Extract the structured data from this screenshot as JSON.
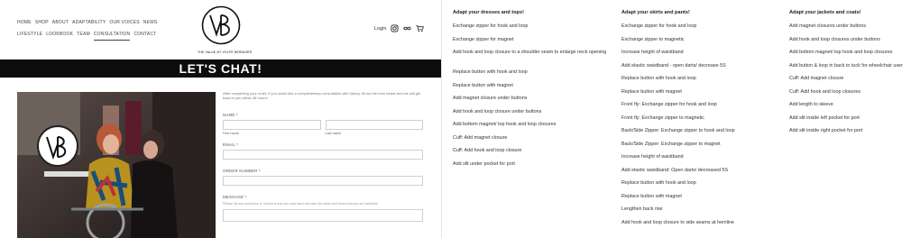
{
  "nav": {
    "row1": [
      "HOME",
      "SHOP",
      "ABOUT",
      "ADAPTABILITY",
      "OUR VOICES",
      "NEWS"
    ],
    "row2": [
      "LIFESTYLE",
      "LOOKBOOK",
      "TEAM",
      "CONSULTATION",
      "CONTACT"
    ],
    "active": "CONSULTATION"
  },
  "logo": {
    "caption": "THE VALUE BY VOLPE BERNIGER",
    "letters": "VB"
  },
  "header_tools": {
    "login": "Login",
    "icons": [
      "instagram-icon",
      "infinity-icon",
      "cart-icon"
    ]
  },
  "banner": {
    "title": "LET'S CHAT!"
  },
  "form": {
    "intro": "After completing your order, if you would like a complimentary consultation with Nancy, fill out the form below and we will get back to you within 48 hours!",
    "name_label": "NAME *",
    "first_name_sub": "First name",
    "last_name_sub": "Last name",
    "email_label": "EMAIL *",
    "order_label": "ORDER NUMBER *",
    "message_label": "MESSAGE *",
    "message_help": "Please list any questions or concerns that you may have and also the dates and times that you are available."
  },
  "lists": [
    {
      "title": "Adapt your dresses and tops!",
      "items": [
        "Exchange zipper for hook and loop",
        "Exchange zipper for magnet",
        "Add hook and loop closure to a shoulder seam to enlarge neck opening",
        "Replace button with hook and loop",
        "Replace button with magnet",
        "Add magnet closure under buttons",
        "Add hook and loop closure under buttons",
        "Add bottom magnet/ top hook and loop closures",
        "Cuff: Add magnet closure",
        "Cuff: Add hook and loop closure",
        "Add slit under pocket for port"
      ]
    },
    {
      "title": "Adapt your skirts and pants!",
      "items": [
        "Exchange zipper for hook and loop",
        "Exchange zipper to magnetic",
        "Increase height of waistband",
        "Add elastic waistband - open darts/ decrease 5S",
        "Replace button with hook and loop",
        "Replace button with magnet",
        "Front fly: Exchange zipper for hook and loop",
        "Front fly: Exchange zipper to magnetic",
        "Back/Side Zipper: Exchange zipper to hook and loop",
        "Back/Side Zipper: Exchange zipper to magnet",
        "Increase height of waistband",
        "Add elastic waistband: Open darts/ decreased 5S",
        "Replace button with hook and loop",
        "Replace button with magnet",
        "Lengthen back rise",
        "Add hook and loop closure to side seams at hemline"
      ]
    },
    {
      "title": "Adapt your jackets and coats!",
      "items": [
        "Add magnet closures under buttons",
        "Add hook and loop closures under buttons",
        "Add bottom magnet/ top hook and loop closures",
        "Add button & loop in back to tuck for wheelchair user",
        "Cuff: Add magnet closure",
        "Cuff: Add hook and loop closures",
        "Add length to sleeve",
        "Add slit inside left pocket for port",
        "Add slit inside right pocket for port"
      ]
    }
  ],
  "colors": {
    "banner_bg": "#0d0d0d",
    "banner_text": "#ffffff",
    "text": "#333333"
  }
}
